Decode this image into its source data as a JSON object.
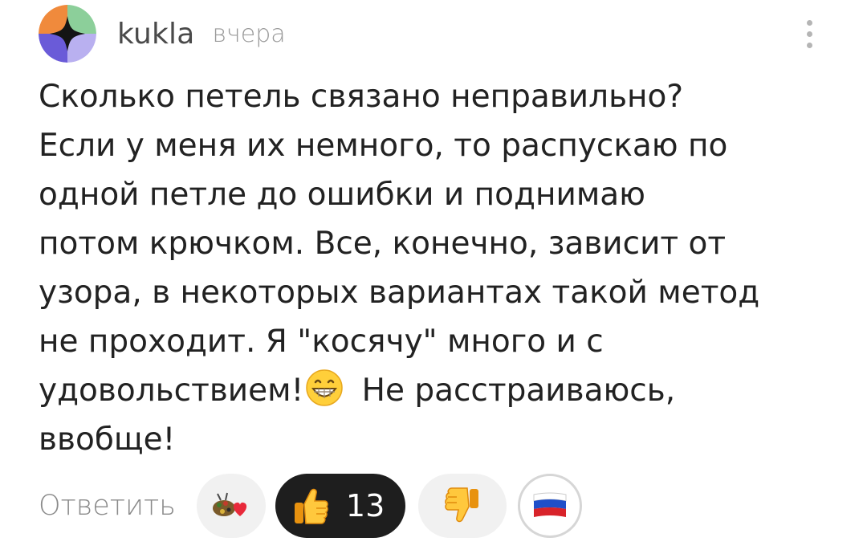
{
  "comment": {
    "author": "kukla",
    "time": "вчера",
    "text_lines": [
      "Сколько петель связано неправильно?",
      "Если у меня их немного, то распускаю по",
      "одной петле до ошибки и поднимаю",
      "потом крючком. Все, конечно, зависит от",
      "узора, в некоторых вариантах такой метод",
      "не проходит. Я \"косячу\" много и с"
    ],
    "text_line7_before_emoji": "удовольствием!",
    "text_line7_after_emoji": " Не расстраиваюсь,",
    "text_line8": "ввобще!",
    "inline_emoji": "grinning-face-icon"
  },
  "actions": {
    "reply_label": "Ответить",
    "reactions": [
      {
        "icon": "sticker-heart-icon",
        "count": null,
        "active": false
      },
      {
        "icon": "thumbs-up-icon",
        "count": "13",
        "active": true
      },
      {
        "icon": "thumbs-down-icon",
        "count": null,
        "active": false
      },
      {
        "icon": "russia-flag-icon",
        "count": null,
        "active": false
      }
    ]
  },
  "colors": {
    "text": "#222222",
    "muted": "#9a9a9a",
    "active_reaction_bg": "#1e1e1e",
    "reaction_bg": "#f1f1f1"
  }
}
